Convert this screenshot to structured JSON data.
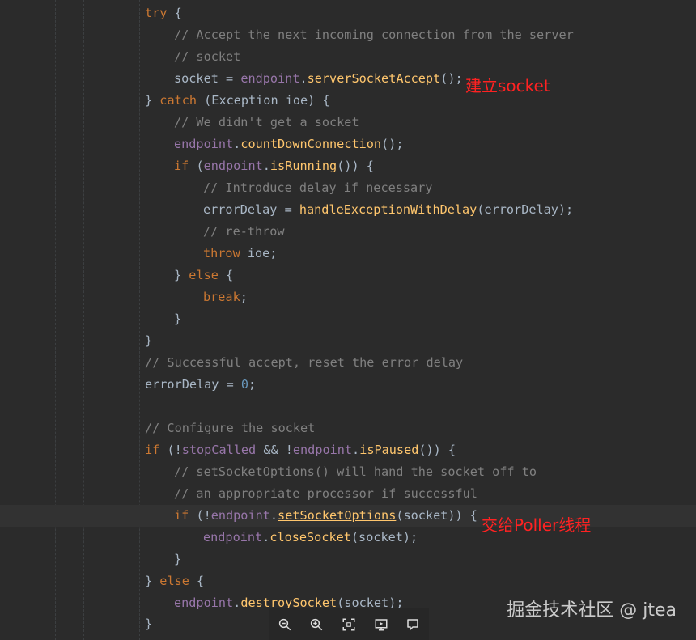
{
  "code": {
    "try_kw": "try",
    "c1": "// Accept the next incoming connection from the server",
    "c2": "// socket",
    "accept": {
      "var": "socket",
      "eq": " = ",
      "obj": "endpoint",
      "dot": ".",
      "fn": "serverSocketAccept",
      "end": "();"
    },
    "catch": {
      "close": "} ",
      "kw": "catch",
      "rest": " (Exception ioe) {"
    },
    "c3": "// We didn't get a socket",
    "countdown": {
      "obj": "endpoint",
      "dot": ".",
      "fn": "countDownConnection",
      "end": "();"
    },
    "if_running": {
      "kw": "if",
      "open": " (",
      "obj": "endpoint",
      "dot": ".",
      "fn": "isRunning",
      "end": "()) {"
    },
    "c4": "// Introduce delay if necessary",
    "errdelay1": {
      "var": "errorDelay",
      "eq": " = ",
      "fn": "handleExceptionWithDelay",
      "end": "(errorDelay);"
    },
    "c5": "// re-throw",
    "throw": {
      "kw": "throw",
      "rest": " ioe;"
    },
    "else1": {
      "close": "} ",
      "kw": "else",
      "rest": " {"
    },
    "brk": {
      "kw": "break",
      "rest": ";"
    },
    "close_a": "}",
    "close_b": "}",
    "c6": "// Successful accept, reset the error delay",
    "errdelay2": {
      "var": "errorDelay",
      "eq": " = ",
      "num": "0",
      "end": ";"
    },
    "c7": "// Configure the socket",
    "if_paused": {
      "kw": "if",
      "open": " (!",
      "fld": "stopCalled",
      "and": " && !",
      "obj": "endpoint",
      "dot": ".",
      "fn": "isPaused",
      "end": "()) {"
    },
    "c8": "// setSocketOptions() will hand the socket off to",
    "c9": "// an appropriate processor if successful",
    "if_opts": {
      "kw": "if",
      "open": " (!",
      "obj": "endpoint",
      "dot": ".",
      "fn": "setSocketOptions",
      "end": "(socket)) {"
    },
    "close_sock": {
      "obj": "endpoint",
      "dot": ".",
      "fn": "closeSocket",
      "end": "(socket);"
    },
    "close_c": "}",
    "else2": {
      "close": "} ",
      "kw": "else",
      "rest": " {"
    },
    "destroy": {
      "obj": "endpoint",
      "dot": ".",
      "fn": "destroySocket",
      "end": "(socket);"
    },
    "close_d": "}"
  },
  "annotations": {
    "accept_note": "建立socket",
    "poller_note": "交给Poller线程"
  },
  "watermark": "掘金技术社区 @ jtea",
  "viewer": {
    "icons": [
      "zoom-out-icon",
      "zoom-in-icon",
      "fit-screen-icon",
      "slideshow-icon",
      "comment-icon"
    ]
  },
  "colors": {
    "background": "#2b2b2b",
    "keyword": "#cc7832",
    "comment": "#808080",
    "method": "#ffc66d",
    "field": "#9876aa",
    "number": "#6897bb",
    "text": "#a9b7c6",
    "annotation": "#ff2222"
  }
}
